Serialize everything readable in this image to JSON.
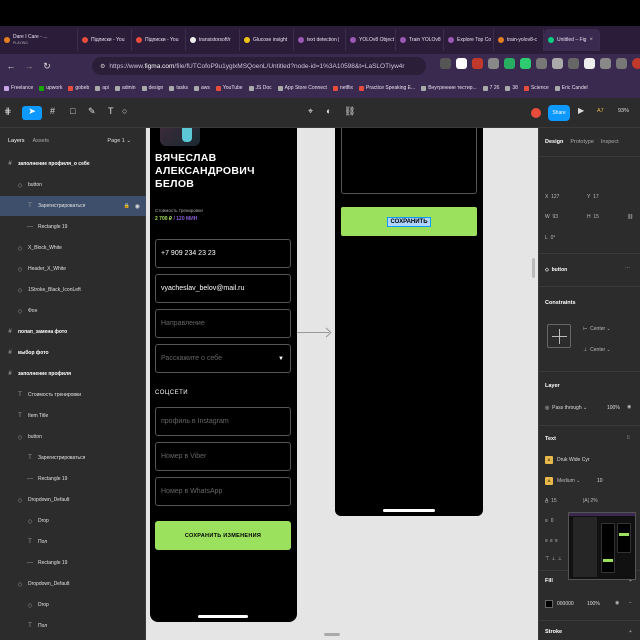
{
  "browser": {
    "tabs": [
      {
        "label": "Dare I Care - ..."
      },
      {
        "label": "Підписки - You"
      },
      {
        "label": "Підписки - You"
      },
      {
        "label": "transistorsoft/r"
      },
      {
        "label": "Glucose insight"
      },
      {
        "label": "text detection |"
      },
      {
        "label": "YOLOv8 Object"
      },
      {
        "label": "Train YOLOv8"
      },
      {
        "label": "Explore Top Co"
      },
      {
        "label": "train-yolov8-c"
      },
      {
        "label": "Untitled – Fig"
      }
    ],
    "tab_sublabel": "PLAYING",
    "url_prefix": "https://www.",
    "url_domain": "figma.com",
    "url_rest": "/file/fUTCofoP9u1yglxMSQoenL/Untitled?node-id=1%3A10598&t=LaSLOTIyw4r",
    "bookmarks": [
      "Freelance",
      "upwork",
      "gobeb",
      "api",
      "admin",
      "design",
      "tasks",
      "aws",
      "YouTube",
      "JS Doc",
      "App Store Connect",
      "netflix",
      "Practice Speaking E...",
      "Внутренние тестир...",
      "7 26",
      "38",
      "Science",
      "Eric Candel"
    ]
  },
  "figma": {
    "share_label": "Share",
    "zoom": "93%",
    "user_initials": "A7",
    "left_panel": {
      "tabs": [
        "Layers",
        "Assets"
      ],
      "page": "Page 1",
      "layers": [
        {
          "label": "заполнение профиля_о себе",
          "bold": true,
          "icon": "#"
        },
        {
          "label": "button",
          "icon": "◇"
        },
        {
          "label": "Зарегистрироваться",
          "icon": "T",
          "selected": true
        },
        {
          "label": "Rectangle 19",
          "icon": "—"
        },
        {
          "label": "X_Block_White",
          "icon": "◇"
        },
        {
          "label": "Header_X_White",
          "icon": "◇"
        },
        {
          "label": "1Stroke_Black_IconLeft",
          "icon": "◇"
        },
        {
          "label": "Фон",
          "icon": "◇"
        },
        {
          "label": "попап_замена фото",
          "bold": true,
          "icon": "#"
        },
        {
          "label": "выбор фото",
          "bold": true,
          "icon": "#"
        },
        {
          "label": "заполнение профиля",
          "bold": true,
          "icon": "#"
        },
        {
          "label": "Стоимость тренировки",
          "icon": "T"
        },
        {
          "label": "Item Title",
          "icon": "T"
        },
        {
          "label": "button",
          "icon": "◇"
        },
        {
          "label": "Зарегистрироваться",
          "icon": "T"
        },
        {
          "label": "Rectangle 19",
          "icon": "—"
        },
        {
          "label": "Dropdown_Default",
          "icon": "◇"
        },
        {
          "label": "Drop",
          "icon": "◇"
        },
        {
          "label": "Пол",
          "icon": "T"
        },
        {
          "label": "Rectangle 19",
          "icon": "—"
        },
        {
          "label": "Dropdown_Default",
          "icon": "◇"
        },
        {
          "label": "Drop",
          "icon": "◇"
        },
        {
          "label": "Пол",
          "icon": "T"
        }
      ]
    },
    "frame1": {
      "name": "ВЯЧЕСЛАВ АЛЕКСАНДРОВИЧ БЕЛОВ",
      "price_label": "Стоимость тренировки",
      "price_value": "2 700 ₽",
      "price_sep": " / ",
      "price_unit": "120 МИН",
      "phone": "+7 909 234 23 23",
      "email": "vyacheslav_belov@mail.ru",
      "direction_ph": "Направление",
      "about_ph": "Расскажите о себе",
      "dropdown_arrow": "▼",
      "social_title": "СОЦСЕТИ",
      "instagram_ph": "профиль в Instagram",
      "viber_ph": "Номер в Viber",
      "whatsapp_ph": "Номер в WhatsApp",
      "save_changes": "СОХРАНИТЬ ИЗМЕНЕНИЯ"
    },
    "frame2": {
      "save": "СОХРАНИТЬ"
    },
    "right_panel": {
      "tabs": [
        "Design",
        "Prototype",
        "Inspect"
      ],
      "x_label": "X",
      "x_value": "127",
      "y_label": "Y",
      "y_value": "17",
      "w_label": "W",
      "w_value": "93",
      "h_label": "H",
      "h_value": "15",
      "angle_label": "L",
      "angle_value": "0°",
      "component": "button",
      "constraints_title": "Constraints",
      "c_h": "Center",
      "c_v": "Center",
      "layer_title": "Layer",
      "blend": "Pass through",
      "opacity": "100%",
      "text_title": "Text",
      "font": "Druk Wide Cyr",
      "weight": "Medium",
      "size": "10",
      "line_height": "15",
      "letter_spacing": "2%",
      "para": "0",
      "fill_title": "Fill",
      "fill_hex": "000000",
      "fill_opacity": "100%",
      "stroke_title": "Stroke"
    }
  }
}
